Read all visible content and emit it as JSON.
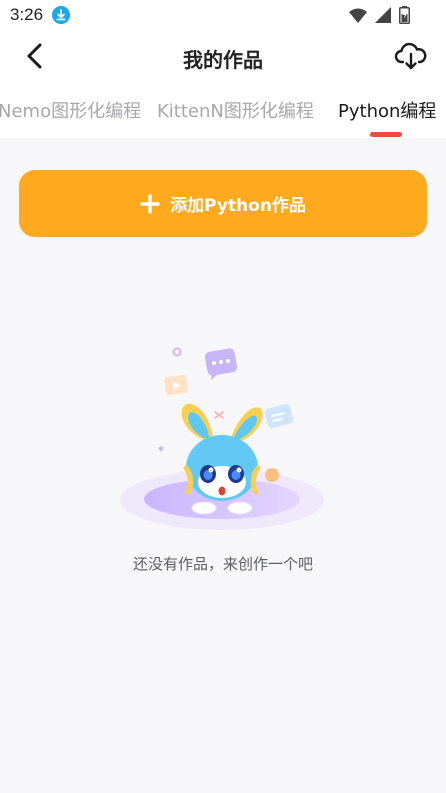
{
  "status_bar": {
    "time": "3:26"
  },
  "header": {
    "title": "我的作品"
  },
  "tabs": [
    {
      "label": "Nemo图形化编程",
      "active": false
    },
    {
      "label": "KittenN图形化编程",
      "active": false
    },
    {
      "label": "Python编程",
      "active": true
    }
  ],
  "add_button": {
    "label": "添加Python作品"
  },
  "empty_state": {
    "message": "还没有作品，来创作一个吧"
  },
  "colors": {
    "accent": "#ffa91e",
    "tab_indicator": "#ef4a3c",
    "download_badge": "#1aa7f0"
  },
  "icons": [
    "download-icon",
    "wifi-icon",
    "signal-icon",
    "battery-icon",
    "back-icon",
    "cloud-download-icon",
    "plus-icon"
  ]
}
